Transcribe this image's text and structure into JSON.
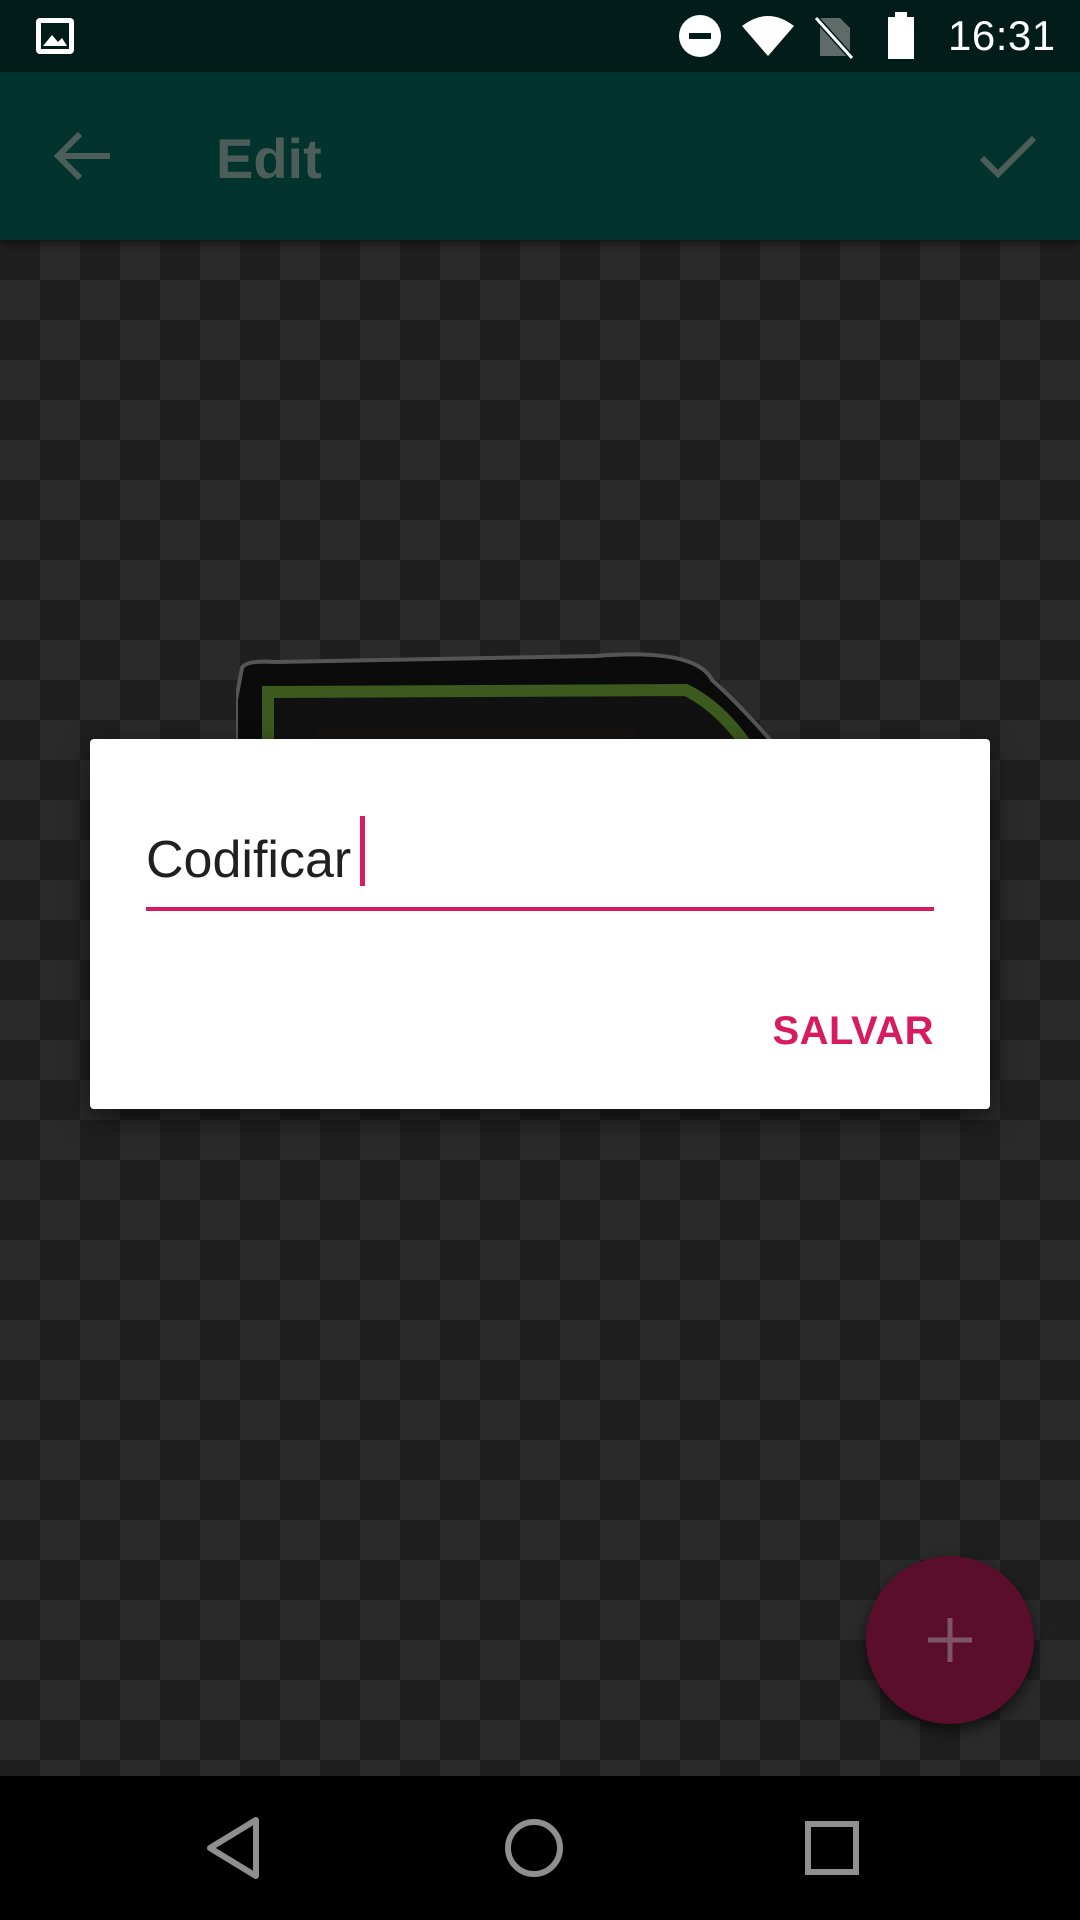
{
  "status_bar": {
    "time": "16:31",
    "icons": [
      "gallery-icon",
      "do-not-disturb-icon",
      "wifi-icon",
      "no-sim-icon",
      "battery-icon"
    ]
  },
  "toolbar": {
    "title": "Edit",
    "back_icon": "arrow-back-icon",
    "confirm_icon": "check-icon"
  },
  "dialog": {
    "input_value": "Codificar",
    "save_label": "SALVAR",
    "accent_color": "#d81b60"
  },
  "fab": {
    "icon": "plus-icon"
  },
  "nav_bar": {
    "icons": [
      "nav-back-icon",
      "nav-home-icon",
      "nav-recents-icon"
    ]
  },
  "colors": {
    "status_bar": "#021d19",
    "toolbar": "#02332c",
    "accent": "#d81b60",
    "fab": "#5a0e2b"
  }
}
